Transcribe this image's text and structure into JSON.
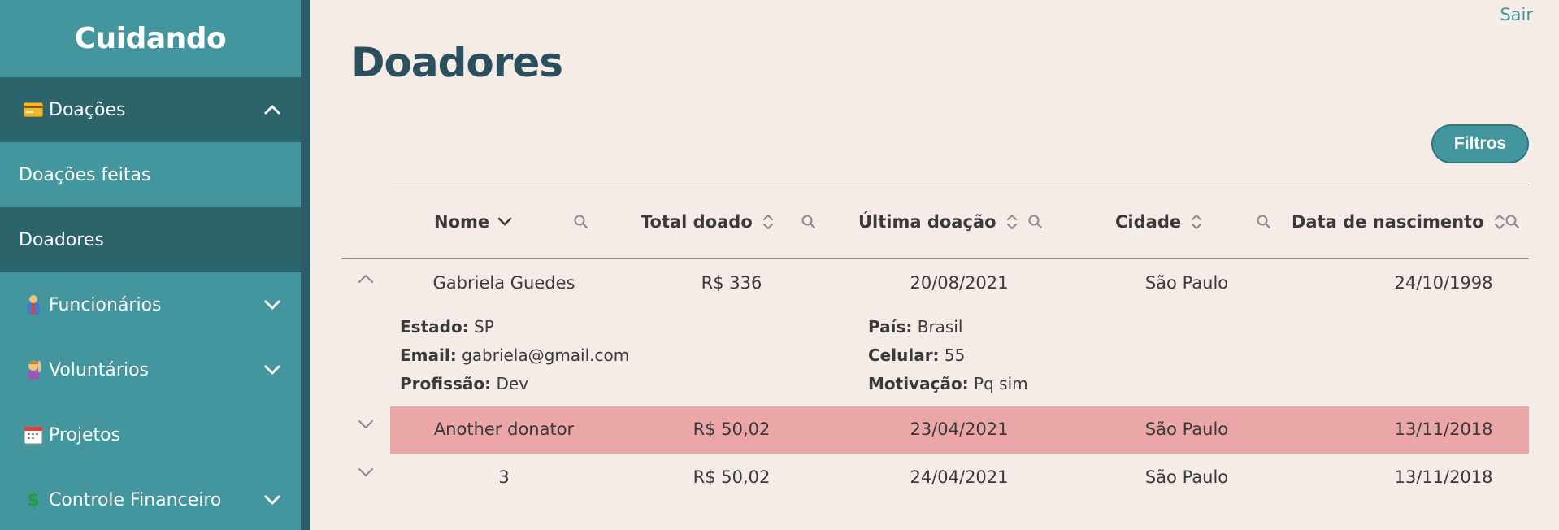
{
  "app": {
    "brand": "Cuidando",
    "logout_label": "Sair"
  },
  "sidebar": {
    "items": [
      {
        "label": "Doações",
        "icon": "credit-card-icon",
        "expanded": true
      },
      {
        "label": "Doações feitas"
      },
      {
        "label": "Doadores",
        "active": true
      },
      {
        "label": "Funcionários",
        "icon": "worker-icon"
      },
      {
        "label": "Voluntários",
        "icon": "volunteer-icon"
      },
      {
        "label": "Projetos",
        "icon": "calendar-icon"
      },
      {
        "label": "Controle Financeiro",
        "icon": "dollar-icon"
      }
    ]
  },
  "page": {
    "title": "Doadores",
    "filters_label": "Filtros"
  },
  "table": {
    "columns": [
      "Nome",
      "Total doado",
      "Última doação",
      "Cidade",
      "Data de nascimento"
    ],
    "rows": [
      {
        "nome": "Gabriela Guedes",
        "total": "R$ 336",
        "ultima": "20/08/2021",
        "cidade": "São Paulo",
        "nascimento": "24/10/1998",
        "expanded": true
      },
      {
        "nome": "Another donator",
        "total": "R$ 50,02",
        "ultima": "23/04/2021",
        "cidade": "São Paulo",
        "nascimento": "13/11/2018",
        "highlighted": true
      },
      {
        "nome": "3",
        "total": "R$ 50,02",
        "ultima": "24/04/2021",
        "cidade": "São Paulo",
        "nascimento": "13/11/2018"
      }
    ],
    "detail": {
      "estado_label": "Estado:",
      "estado": "SP",
      "email_label": "Email:",
      "email": "gabriela@gmail.com",
      "profissao_label": "Profissão:",
      "profissao": "Dev",
      "pais_label": "País:",
      "pais": "Brasil",
      "celular_label": "Celular:",
      "celular": "55",
      "motivacao_label": "Motivação:",
      "motivacao": "Pq sim"
    }
  },
  "colors": {
    "sidebar": "#43959e",
    "sidebar_dark": "#2c646c",
    "background": "#f5ebe7",
    "highlight_row": "#eba6a8",
    "title": "#2c4f5e"
  }
}
